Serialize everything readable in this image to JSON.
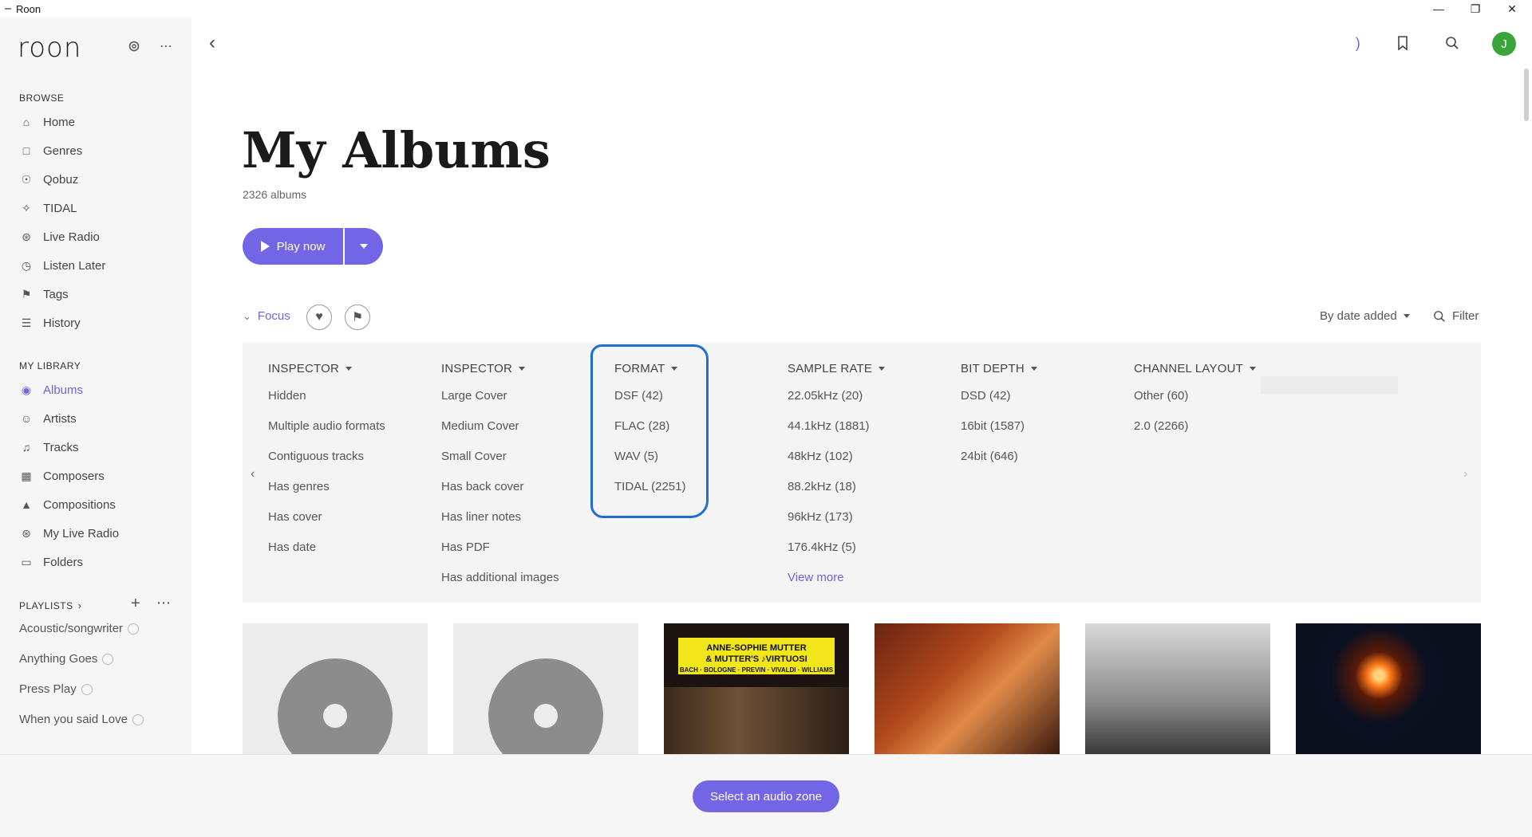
{
  "window": {
    "title": "Roon",
    "controls": [
      "minimize-icon",
      "restore-icon",
      "close-icon"
    ]
  },
  "sidebar": {
    "logo": "roon",
    "browse_header": "BROWSE",
    "browse_items": [
      {
        "label": "Home",
        "icon": "home-icon"
      },
      {
        "label": "Genres",
        "icon": "genres-icon"
      },
      {
        "label": "Qobuz",
        "icon": "qobuz-icon"
      },
      {
        "label": "TIDAL",
        "icon": "tidal-icon"
      },
      {
        "label": "Live Radio",
        "icon": "radio-icon"
      },
      {
        "label": "Listen Later",
        "icon": "clock-icon"
      },
      {
        "label": "Tags",
        "icon": "tag-icon"
      },
      {
        "label": "History",
        "icon": "history-icon"
      }
    ],
    "library_header": "MY LIBRARY",
    "library_items": [
      {
        "label": "Albums",
        "icon": "album-icon",
        "active": true
      },
      {
        "label": "Artists",
        "icon": "artist-icon"
      },
      {
        "label": "Tracks",
        "icon": "music-note-icon"
      },
      {
        "label": "Composers",
        "icon": "composer-icon"
      },
      {
        "label": "Compositions",
        "icon": "composition-icon"
      },
      {
        "label": "My Live Radio",
        "icon": "radio-icon"
      },
      {
        "label": "Folders",
        "icon": "folder-icon"
      }
    ],
    "playlists_header": "PLAYLISTS",
    "playlists": [
      "Acoustic/songwriter",
      "Anything Goes",
      "Press Play",
      "When you said Love"
    ]
  },
  "header": {
    "title": "My Albums",
    "count": "2326 albums",
    "play_label": "Play now"
  },
  "toolbar": {
    "focus_label": "Focus",
    "sort_label": "By date added",
    "filter_label": "Filter"
  },
  "focus_panel": {
    "columns": [
      {
        "header": "INSPECTOR",
        "items": [
          "Hidden",
          "Multiple audio formats",
          "Contiguous tracks",
          "Has genres",
          "Has cover",
          "Has date"
        ]
      },
      {
        "header": "INSPECTOR",
        "items": [
          "Large Cover",
          "Medium Cover",
          "Small Cover",
          "Has back cover",
          "Has liner notes",
          "Has PDF",
          "Has additional images"
        ]
      },
      {
        "header": "FORMAT",
        "items": [
          "DSF (42)",
          "FLAC (28)",
          "WAV (5)",
          "TIDAL (2251)"
        ]
      },
      {
        "header": "SAMPLE RATE",
        "items": [
          "22.05kHz (20)",
          "44.1kHz (1881)",
          "48kHz (102)",
          "88.2kHz (18)",
          "96kHz (173)",
          "176.4kHz (5)"
        ],
        "more": "View more"
      },
      {
        "header": "BIT DEPTH",
        "items": [
          "DSD (42)",
          "16bit (1587)",
          "24bit (646)"
        ]
      },
      {
        "header": "CHANNEL LAYOUT",
        "items": [
          "Other (60)",
          "2.0 (2266)"
        ]
      }
    ]
  },
  "albums": {
    "mutter_title": "ANNE-SOPHIE MUTTER",
    "mutter_subtitle": "& MUTTER'S ♪VIRTUOSI",
    "mutter_composers": "BACH · BOLOGNE · PREVIN · VIVALDI · WILLIAMS"
  },
  "footer": {
    "zone_label": "Select an audio zone"
  },
  "colors": {
    "accent": "#7266e6",
    "highlight": "#1f6fd1",
    "avatar": "#3ba43b"
  },
  "user": {
    "initial": "J"
  }
}
